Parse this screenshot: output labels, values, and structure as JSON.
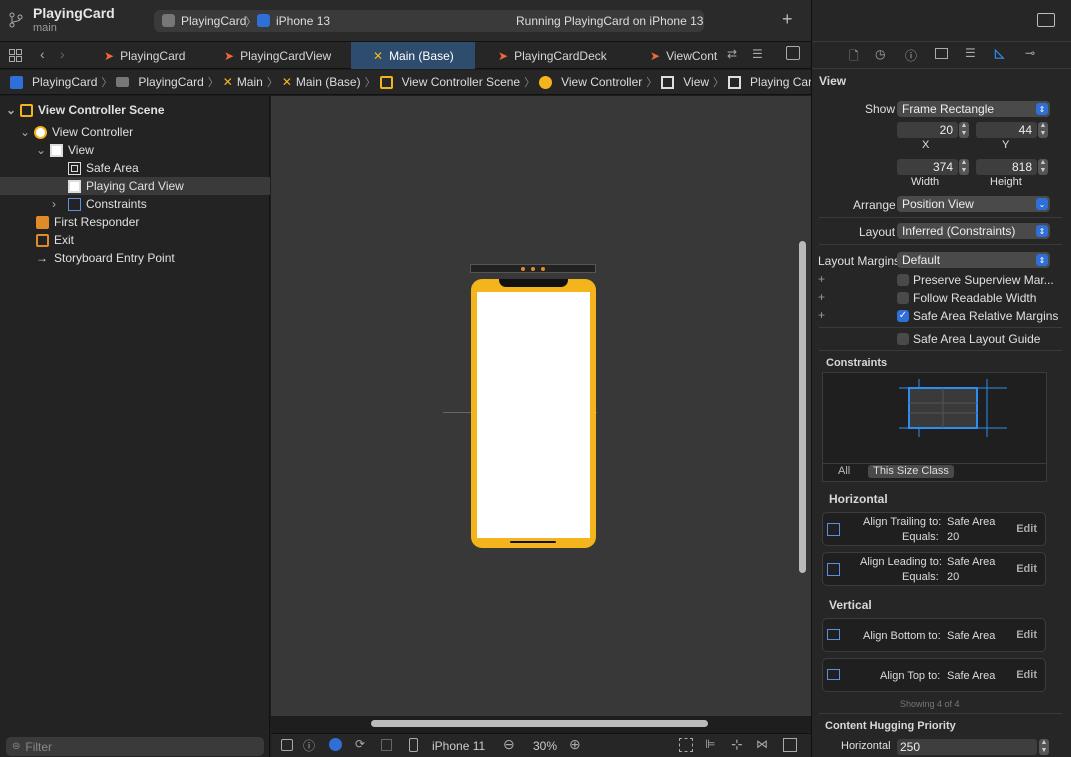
{
  "project": {
    "title": "PlayingCard",
    "branch": "main"
  },
  "scheme": {
    "target": "PlayingCard",
    "device": "iPhone 13",
    "status": "Running PlayingCard on iPhone 13"
  },
  "tabs": [
    "PlayingCard",
    "PlayingCardView",
    "Main (Base)",
    "PlayingCardDeck",
    "ViewCont"
  ],
  "breadcrumbs": [
    "PlayingCard",
    "PlayingCard",
    "Main",
    "Main (Base)",
    "View Controller Scene",
    "View Controller",
    "View",
    "Playing Card View"
  ],
  "navigator": {
    "items": [
      "View Controller Scene",
      "View Controller",
      "View",
      "Safe Area",
      "Playing Card View",
      "Constraints",
      "First Responder",
      "Exit",
      "Storyboard Entry Point"
    ],
    "filter_placeholder": "Filter"
  },
  "canvas": {
    "device": "iPhone 11",
    "zoom": "30%"
  },
  "inspector": {
    "section": "View",
    "show_label": "Show",
    "show_value": "Frame Rectangle",
    "x": "20",
    "y": "44",
    "width": "374",
    "height": "818",
    "x_label": "X",
    "y_label": "Y",
    "width_label": "Width",
    "height_label": "Height",
    "arrange_label": "Arrange",
    "arrange_value": "Position View",
    "layout_label": "Layout",
    "layout_value": "Inferred (Constraints)",
    "margins_label": "Layout Margins",
    "margins_value": "Default",
    "preserve": "Preserve Superview Mar...",
    "readable": "Follow Readable Width",
    "safe_margins": "Safe Area Relative Margins",
    "safe_guide": "Safe Area Layout Guide",
    "constraints_header": "Constraints",
    "all": "All",
    "size_class": "This Size Class",
    "horizontal": "Horizontal",
    "vertical": "Vertical",
    "c1": {
      "a": "Align Trailing to:",
      "b": "Safe Area",
      "c": "Equals:",
      "d": "20"
    },
    "c2": {
      "a": "Align Leading to:",
      "b": "Safe Area",
      "c": "Equals:",
      "d": "20"
    },
    "c3": {
      "a": "Align Bottom to:",
      "b": "Safe Area"
    },
    "c4": {
      "a": "Align Top to:",
      "b": "Safe Area"
    },
    "edit": "Edit",
    "showing": "Showing 4 of 4",
    "hugging": "Content Hugging Priority",
    "hug_label": "Horizontal",
    "hug_value": "250"
  },
  "colors": {
    "accent": "#2f6fd8",
    "phone": "#f4b51c",
    "tab_active": "#2e4d6e"
  }
}
